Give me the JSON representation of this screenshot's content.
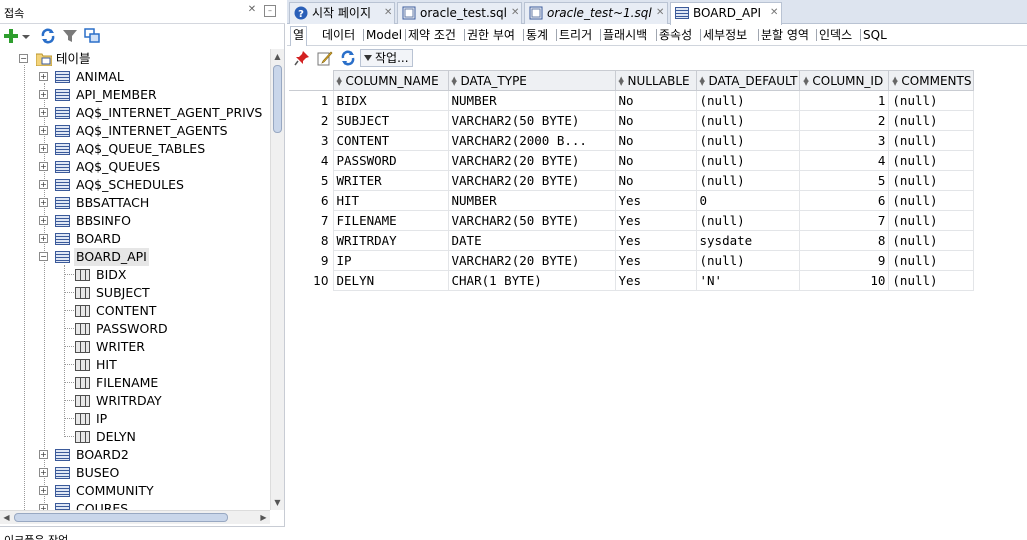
{
  "left_panel": {
    "title": "접속",
    "recent_title": "이크플은 작업"
  },
  "tree": {
    "root_label": "테이블",
    "tables_before": [
      "ANIMAL",
      "API_MEMBER",
      "AQ$_INTERNET_AGENT_PRIVS",
      "AQ$_INTERNET_AGENTS",
      "AQ$_QUEUE_TABLES",
      "AQ$_QUEUES",
      "AQ$_SCHEDULES",
      "BBSATTACH",
      "BBSINFO",
      "BOARD"
    ],
    "expanded_table": "BOARD_API",
    "columns": [
      "BIDX",
      "SUBJECT",
      "CONTENT",
      "PASSWORD",
      "WRITER",
      "HIT",
      "FILENAME",
      "WRITRDAY",
      "IP",
      "DELYN"
    ],
    "tables_after": [
      "BOARD2",
      "BUSEO",
      "COMMUNITY",
      "COURES"
    ]
  },
  "editor_tabs": [
    {
      "label": "시작 페이지",
      "icon": "help-icon",
      "active": false
    },
    {
      "label": "oracle_test.sql",
      "icon": "sql-file-icon",
      "active": false
    },
    {
      "label": "oracle_test~1.sql",
      "icon": "sql-file-icon",
      "active": false,
      "italic": true
    },
    {
      "label": "BOARD_API",
      "icon": "table-icon",
      "active": true
    }
  ],
  "sub_tabs": [
    "열",
    "데이터",
    "Model",
    "제약 조건",
    "권한 부여",
    "통계",
    "트리거",
    "플래시백",
    "종속성",
    "세부정보",
    "분할 영역",
    "인덱스",
    "SQL"
  ],
  "action_bar": {
    "actions_label": "작업..."
  },
  "grid": {
    "headers": [
      "COLUMN_NAME",
      "DATA_TYPE",
      "NULLABLE",
      "DATA_DEFAULT",
      "COLUMN_ID",
      "COMMENTS"
    ],
    "rows": [
      [
        "1",
        "BIDX",
        "NUMBER",
        "No",
        "(null)",
        "1",
        "(null)"
      ],
      [
        "2",
        "SUBJECT",
        "VARCHAR2(50 BYTE)",
        "No",
        "(null)",
        "2",
        "(null)"
      ],
      [
        "3",
        "CONTENT",
        "VARCHAR2(2000 B...",
        "No",
        "(null)",
        "3",
        "(null)"
      ],
      [
        "4",
        "PASSWORD",
        "VARCHAR2(20 BYTE)",
        "No",
        "(null)",
        "4",
        "(null)"
      ],
      [
        "5",
        "WRITER",
        "VARCHAR2(20 BYTE)",
        "No",
        "(null)",
        "5",
        "(null)"
      ],
      [
        "6",
        "HIT",
        "NUMBER",
        "Yes",
        "0",
        "6",
        "(null)"
      ],
      [
        "7",
        "FILENAME",
        "VARCHAR2(50 BYTE)",
        "Yes",
        "(null)",
        "7",
        "(null)"
      ],
      [
        "8",
        "WRITRDAY",
        "DATE",
        "Yes",
        "sysdate",
        "8",
        "(null)"
      ],
      [
        "9",
        "IP",
        "VARCHAR2(20 BYTE)",
        "Yes",
        "(null)",
        "9",
        "(null)"
      ],
      [
        "10",
        "DELYN",
        "CHAR(1 BYTE)",
        "Yes",
        "'N'",
        "10",
        "(null)"
      ]
    ]
  }
}
